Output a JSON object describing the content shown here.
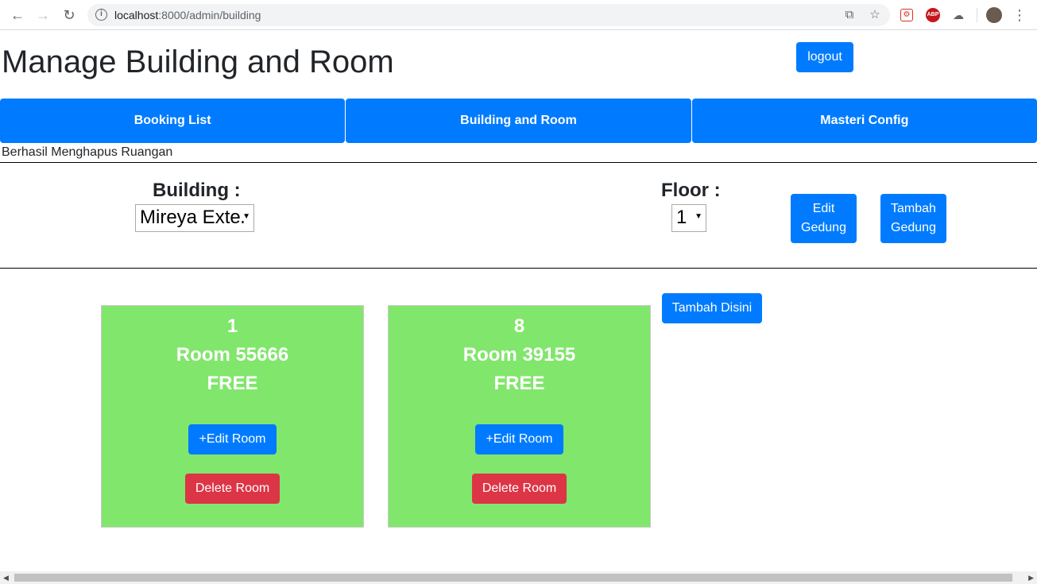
{
  "browser": {
    "url_host": "localhost",
    "url_rest": ":8000/admin/building",
    "icons": {
      "back": "arrow-left-icon",
      "forward": "arrow-right-icon",
      "reload": "reload-icon",
      "info": "info-icon",
      "open": "open-in-new-icon",
      "star": "star-icon",
      "menu": "kebab-menu-icon"
    },
    "ext_abp": "ABP"
  },
  "page": {
    "title": "Manage Building and Room",
    "logout_label": "logout"
  },
  "tabs": [
    {
      "label": "Booking List"
    },
    {
      "label": "Building and Room"
    },
    {
      "label": "Masteri Config"
    }
  ],
  "alert": "Berhasil Menghapus Ruangan",
  "filters": {
    "building_label": "Building :",
    "building_value": "Mireya Exter",
    "floor_label": "Floor :",
    "floor_value": "1"
  },
  "actions": {
    "edit_gedung_line1": "Edit",
    "edit_gedung_line2": "Gedung",
    "tambah_gedung_line1": "Tambah",
    "tambah_gedung_line2": "Gedung",
    "tambah_disini": "Tambah Disini"
  },
  "rooms": [
    {
      "number": "1",
      "name": "Room 55666",
      "status": "FREE",
      "edit_label": "+Edit Room",
      "delete_label": "Delete Room"
    },
    {
      "number": "8",
      "name": "Room 39155",
      "status": "FREE",
      "edit_label": "+Edit Room",
      "delete_label": "Delete Room"
    }
  ],
  "colors": {
    "primary": "#007bff",
    "danger": "#dc3545",
    "room_free": "#81e66c"
  }
}
